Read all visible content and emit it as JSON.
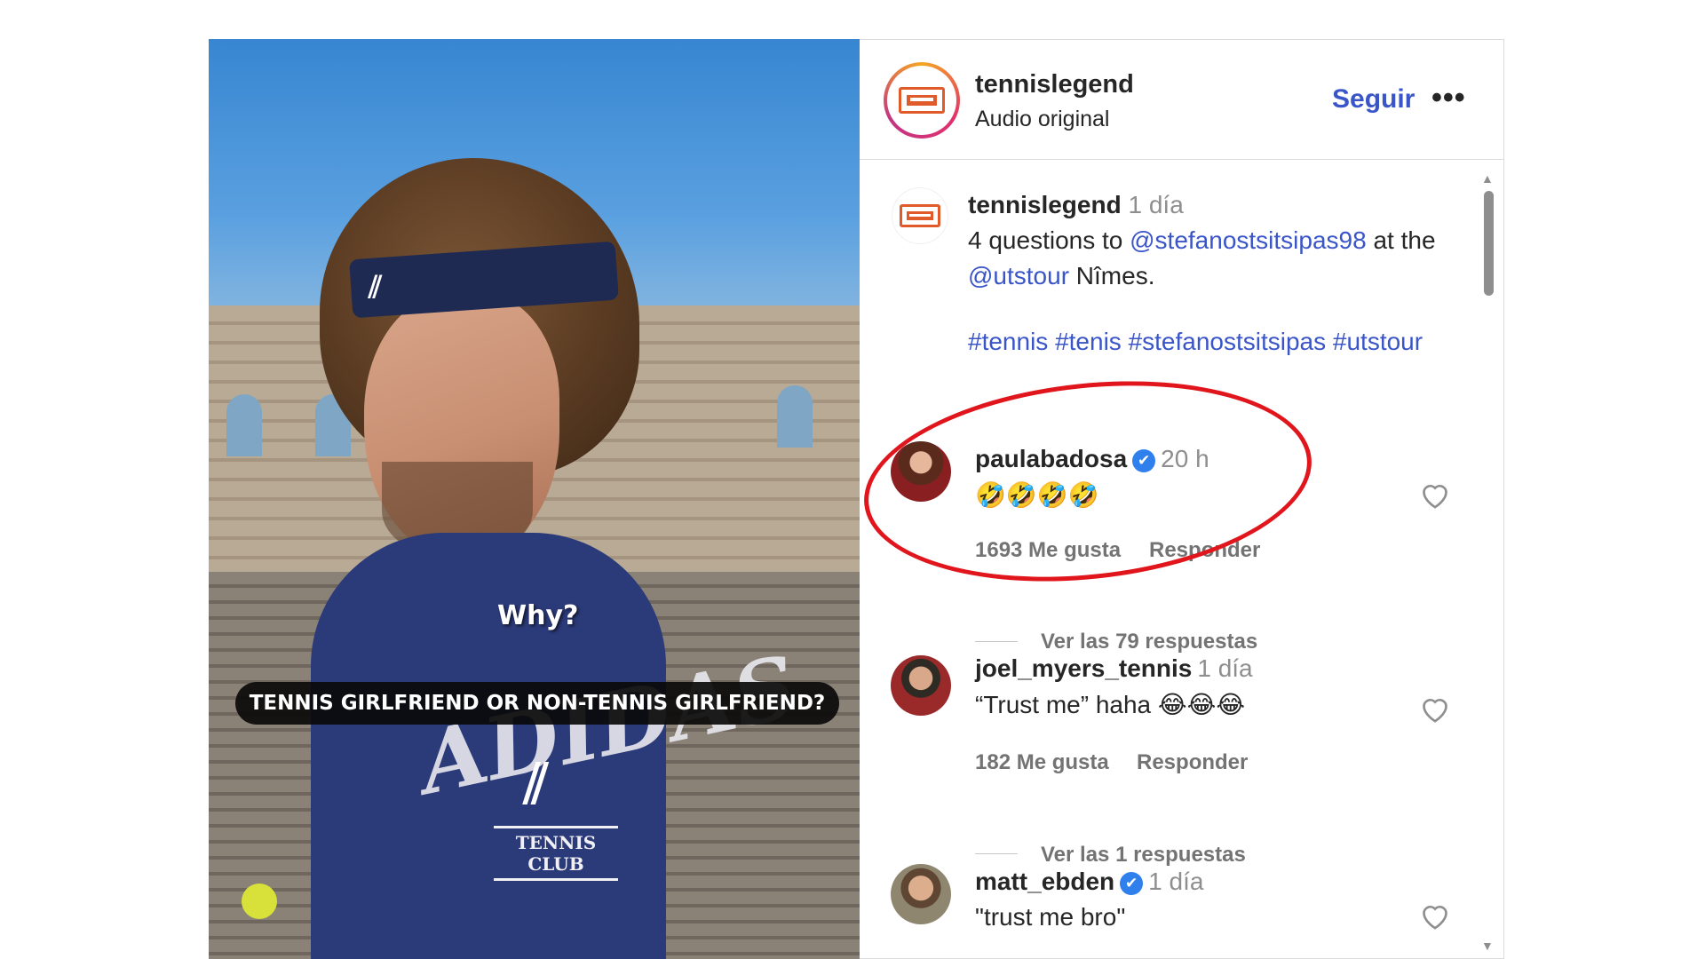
{
  "video": {
    "caption_why": "Why?",
    "caption_question": "TENNIS GIRLFRIEND OR NON-TENNIS GIRLFRIEND?",
    "shirt_brand": "ADIDAS",
    "shirt_club": "TENNIS CLUB"
  },
  "header": {
    "username": "tennislegend",
    "subtitle": "Audio original",
    "follow_label": "Seguir",
    "more_label": "•••"
  },
  "caption": {
    "username": "tennislegend",
    "time": "1 día",
    "text_part1": "4 questions to ",
    "mention1": "@stefanostsitsipas98",
    "text_part2": " at the ",
    "mention2": "@utstour",
    "text_part3": " Nîmes.",
    "hashtags": "#tennis #tenis #stefanostsitsipas #utstour"
  },
  "comments": [
    {
      "username": "paulabadosa",
      "verified": true,
      "time": "20 h",
      "text": "🤣🤣🤣🤣",
      "likes": "1693 Me gusta",
      "reply_label": "Responder",
      "view_replies": "Ver las 79 respuestas"
    },
    {
      "username": "joel_myers_tennis",
      "verified": false,
      "time": "1 día",
      "text": "“Trust me” haha 😂😂😂",
      "likes": "182 Me gusta",
      "reply_label": "Responder",
      "view_replies": "Ver las 1 respuestas"
    },
    {
      "username": "matt_ebden",
      "verified": true,
      "time": "1 día",
      "text": "\"trust me bro\""
    }
  ],
  "icons": {
    "verified": "✔",
    "scroll_up": "▲",
    "scroll_down": "▼"
  },
  "colors": {
    "link": "#3a55c8",
    "highlight": "#e0161c",
    "verified": "#2f80ed"
  }
}
